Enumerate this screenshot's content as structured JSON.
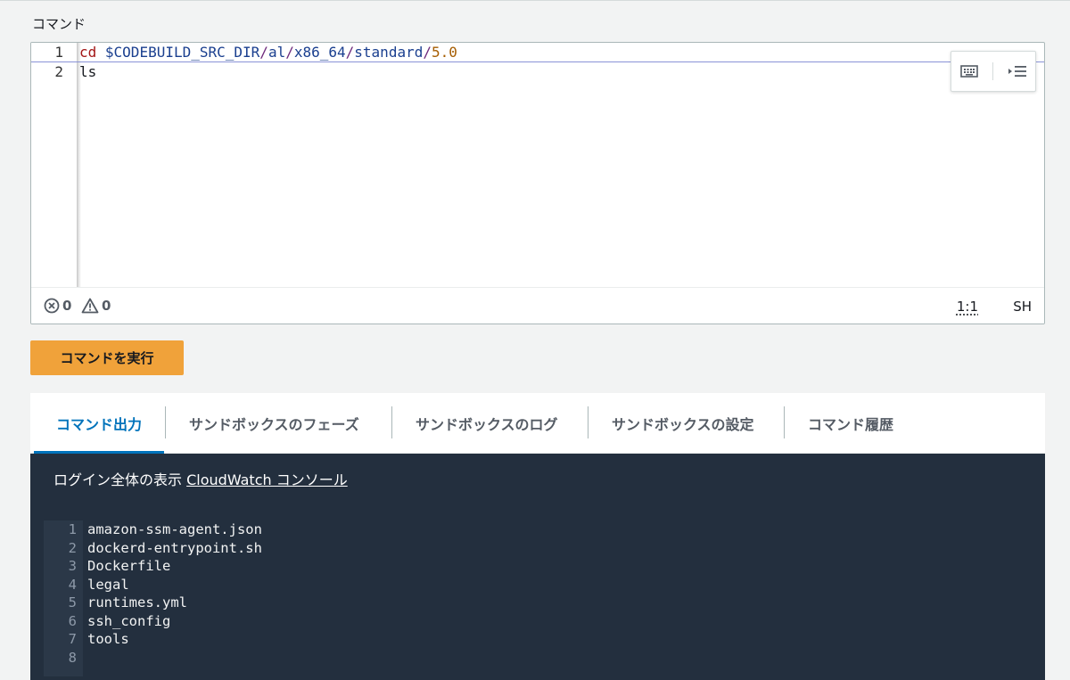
{
  "section_label": "コマンド",
  "editor": {
    "lines": [
      {
        "num": "1",
        "tokens": [
          {
            "t": "cd",
            "c": "kw"
          },
          {
            "t": " "
          },
          {
            "t": "$CODEBUILD_SRC_DIR",
            "c": "var"
          },
          {
            "t": "/",
            "c": "sep"
          },
          {
            "t": "al",
            "c": "var"
          },
          {
            "t": "/",
            "c": "sep"
          },
          {
            "t": "x86_64",
            "c": "var"
          },
          {
            "t": "/",
            "c": "sep"
          },
          {
            "t": "standard",
            "c": "var"
          },
          {
            "t": "/",
            "c": "sep"
          },
          {
            "t": "5.0",
            "c": "num"
          }
        ]
      },
      {
        "num": "2",
        "tokens": [
          {
            "t": "ls"
          }
        ]
      }
    ],
    "errors": "0",
    "warnings": "0",
    "cursor": "1:1",
    "language": "SH"
  },
  "run_button": "コマンドを実行",
  "tabs": [
    {
      "label": "コマンド出力",
      "active": true
    },
    {
      "label": "サンドボックスのフェーズ"
    },
    {
      "label": "サンドボックスのログ"
    },
    {
      "label": "サンドボックスの設定"
    },
    {
      "label": "コマンド履歴"
    }
  ],
  "output": {
    "note_prefix": "ログイン全体の表示",
    "note_link": "CloudWatch コンソール",
    "lines": [
      {
        "num": "1",
        "text": "amazon-ssm-agent.json"
      },
      {
        "num": "2",
        "text": "dockerd-entrypoint.sh"
      },
      {
        "num": "3",
        "text": "Dockerfile"
      },
      {
        "num": "4",
        "text": "legal"
      },
      {
        "num": "5",
        "text": "runtimes.yml"
      },
      {
        "num": "6",
        "text": "ssh_config"
      },
      {
        "num": "7",
        "text": "tools"
      },
      {
        "num": "8",
        "text": ""
      }
    ]
  },
  "colors": {
    "accent": "#0073bb",
    "run_button": "#f0a23a",
    "output_bg": "#232f3e"
  },
  "icons": {
    "keyboard": "keyboard-icon",
    "indent": "indent-icon",
    "error": "error-circle-icon",
    "warning": "warning-triangle-icon"
  }
}
